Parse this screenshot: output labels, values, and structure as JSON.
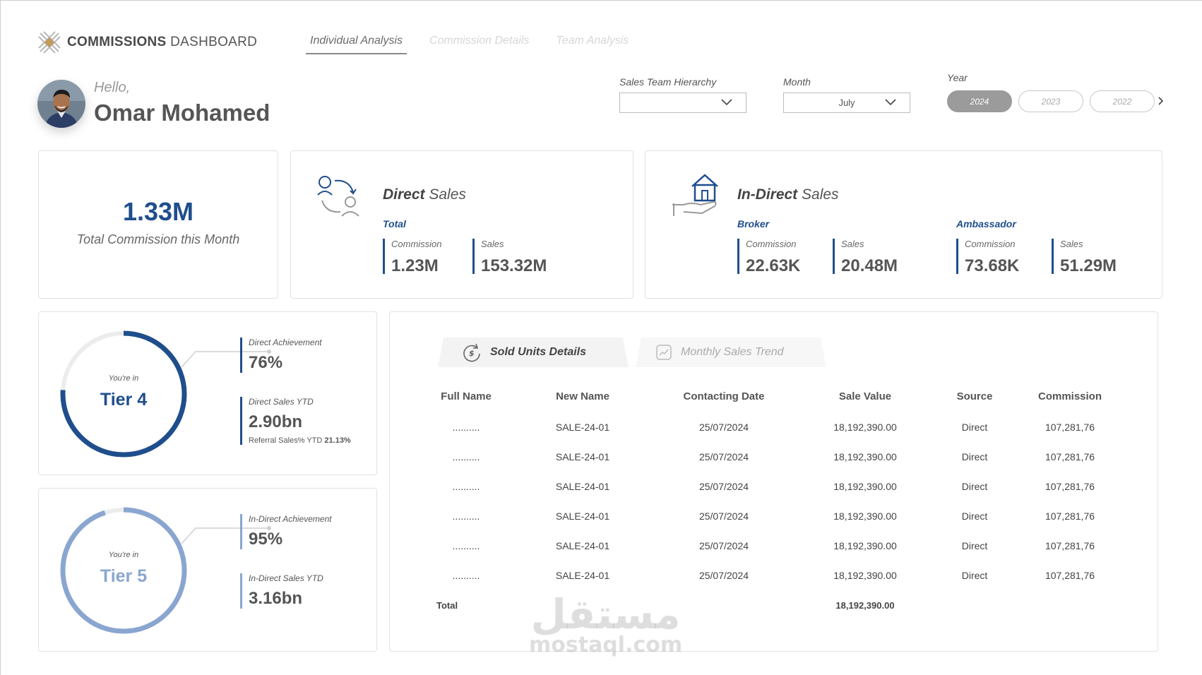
{
  "header": {
    "brand_bold": "COMMISSIONS",
    "brand_rest": " DASHBOARD",
    "tabs": [
      {
        "label": "Individual Analysis",
        "active": true
      },
      {
        "label": "Commission Details",
        "active": false
      },
      {
        "label": "Team Analysis",
        "active": false
      }
    ]
  },
  "user": {
    "greeting": "Hello,",
    "name": "Omar Mohamed"
  },
  "filters": {
    "hierarchy": {
      "label": "Sales Team Hierarchy",
      "value": ""
    },
    "month": {
      "label": "Month",
      "value": "July"
    },
    "year": {
      "label": "Year",
      "options": [
        "2024",
        "2023",
        "2022"
      ],
      "selected": "2024"
    }
  },
  "total_commission": {
    "value": "1.33M",
    "label": "Total Commission this Month"
  },
  "direct_sales": {
    "title_bold": "Direct",
    "title_rest": " Sales",
    "group_label": "Total",
    "commission_label": "Commission",
    "commission_value": "1.23M",
    "sales_label": "Sales",
    "sales_value": "153.32M"
  },
  "indirect_sales": {
    "title_bold": "In-Direct",
    "title_rest": " Sales",
    "broker": {
      "label": "Broker",
      "commission_label": "Commission",
      "commission_value": "22.63K",
      "sales_label": "Sales",
      "sales_value": "20.48M"
    },
    "ambassador": {
      "label": "Ambassador",
      "commission_label": "Commission",
      "commission_value": "73.68K",
      "sales_label": "Sales",
      "sales_value": "51.29M"
    }
  },
  "tier_direct": {
    "prefix": "You're in",
    "tier": "Tier 4",
    "progress": 0.76,
    "color": "#1f4e8c",
    "achievement_label": "Direct Achievement",
    "achievement_value": "76%",
    "ytd_label": "Direct Sales YTD",
    "ytd_value": "2.90bn",
    "referral_label": "Referral Sales% YTD",
    "referral_value": "21.13%"
  },
  "tier_indirect": {
    "prefix": "You're in",
    "tier": "Tier 5",
    "progress": 0.95,
    "color": "#8aa6d0",
    "achievement_label": "In-Direct Achievement",
    "achievement_value": "95%",
    "ytd_label": "In-Direct Sales YTD",
    "ytd_value": "3.16bn"
  },
  "details": {
    "tabs": [
      {
        "label": "Sold Units Details",
        "icon": "dollar-refresh-icon",
        "active": true
      },
      {
        "label": "Monthly Sales Trend",
        "icon": "trend-chart-icon",
        "active": false
      }
    ],
    "columns": [
      "Full Name",
      "New Name",
      "Contacting Date",
      "Sale Value",
      "Source",
      "Commission"
    ],
    "rows": [
      [
        "..........",
        "SALE-24-01",
        "25/07/2024",
        "18,192,390.00",
        "Direct",
        "107,281,76"
      ],
      [
        "..........",
        "SALE-24-01",
        "25/07/2024",
        "18,192,390.00",
        "Direct",
        "107,281,76"
      ],
      [
        "..........",
        "SALE-24-01",
        "25/07/2024",
        "18,192,390.00",
        "Direct",
        "107,281,76"
      ],
      [
        "..........",
        "SALE-24-01",
        "25/07/2024",
        "18,192,390.00",
        "Direct",
        "107,281,76"
      ],
      [
        "..........",
        "SALE-24-01",
        "25/07/2024",
        "18,192,390.00",
        "Direct",
        "107,281,76"
      ],
      [
        "..........",
        "SALE-24-01",
        "25/07/2024",
        "18,192,390.00",
        "Direct",
        "107,281,76"
      ]
    ],
    "total_label": "Total",
    "total_value": "18,192,390.00"
  },
  "watermark": {
    "arabic": "مستقل",
    "latin": "mostaql.com"
  },
  "colors": {
    "accent": "#1f4e8c",
    "accent_light": "#8aa6d0"
  }
}
